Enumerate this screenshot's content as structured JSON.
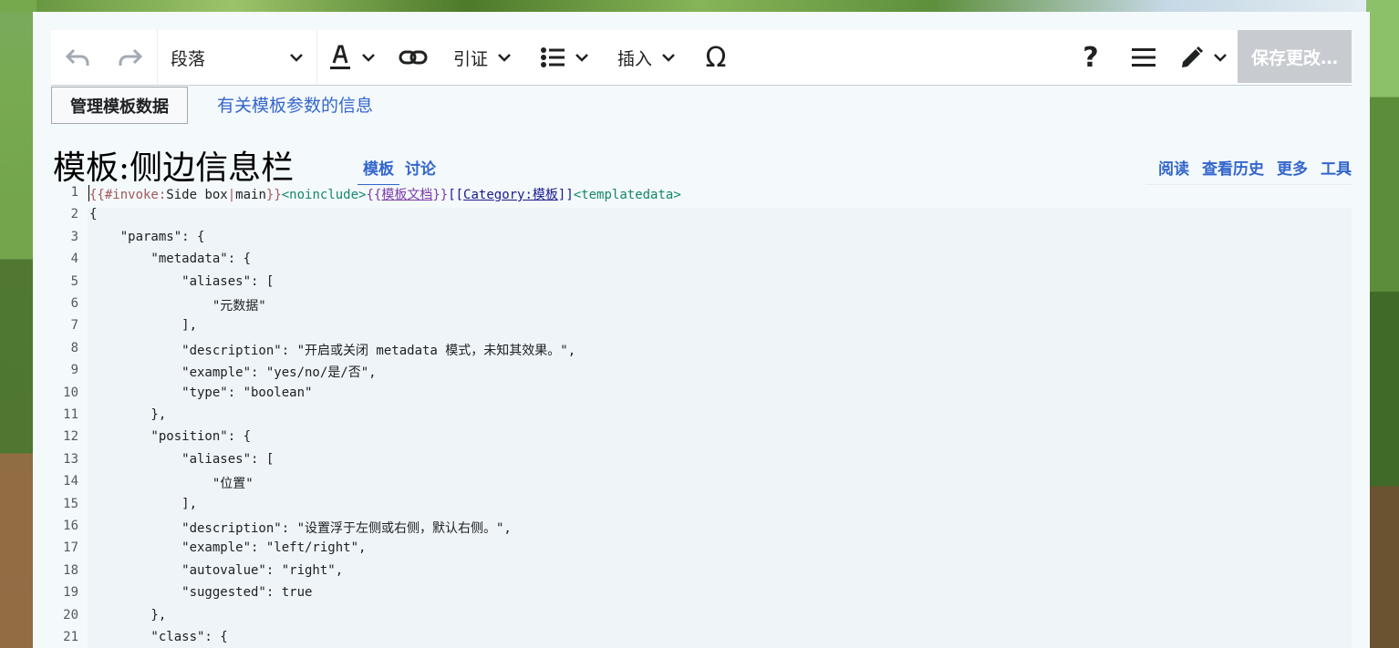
{
  "toolbar": {
    "paragraph_label": "段落",
    "cite_label": "引证",
    "insert_label": "插入",
    "save_label": "保存更改…"
  },
  "templatedata": {
    "manage_button": "管理模板数据",
    "info_link": "有关模板参数的信息"
  },
  "page": {
    "title": "模板:侧边信息栏",
    "tabs": [
      "模板",
      "讨论"
    ],
    "actions": [
      "阅读",
      "查看历史",
      "更多",
      "工具"
    ]
  },
  "editor": {
    "line_numbers": [
      "1",
      "2",
      "3",
      "4",
      "5",
      "6",
      "7",
      "8",
      "9",
      "10",
      "11",
      "12",
      "13",
      "14",
      "15",
      "16",
      "17",
      "18",
      "19",
      "20",
      "21"
    ],
    "line1": {
      "invoke_open": "{{#invoke:",
      "invoke_body": "Side box",
      "invoke_sep": "|",
      "invoke_arg": "main",
      "invoke_close": "}}",
      "noinclude": "<noinclude>",
      "doc_open": "{{",
      "doc_name": "模板文档",
      "doc_close": "}}",
      "cat_open": "[[",
      "cat_name": "Category:模板",
      "cat_close": "]]",
      "templatedata": "<templatedata>"
    },
    "lines": [
      "{",
      "    \"params\": {",
      "        \"metadata\": {",
      "            \"aliases\": [",
      "                \"元数据\"",
      "            ],",
      "            \"description\": \"开启或关闭 metadata 模式，未知其效果。\",",
      "            \"example\": \"yes/no/是/否\",",
      "            \"type\": \"boolean\"",
      "        },",
      "        \"position\": {",
      "            \"aliases\": [",
      "                \"位置\"",
      "            ],",
      "            \"description\": \"设置浮于左侧或右侧，默认右侧。\",",
      "            \"example\": \"left/right\",",
      "            \"autovalue\": \"right\",",
      "            \"suggested\": true",
      "        },",
      "        \"class\": {"
    ]
  }
}
